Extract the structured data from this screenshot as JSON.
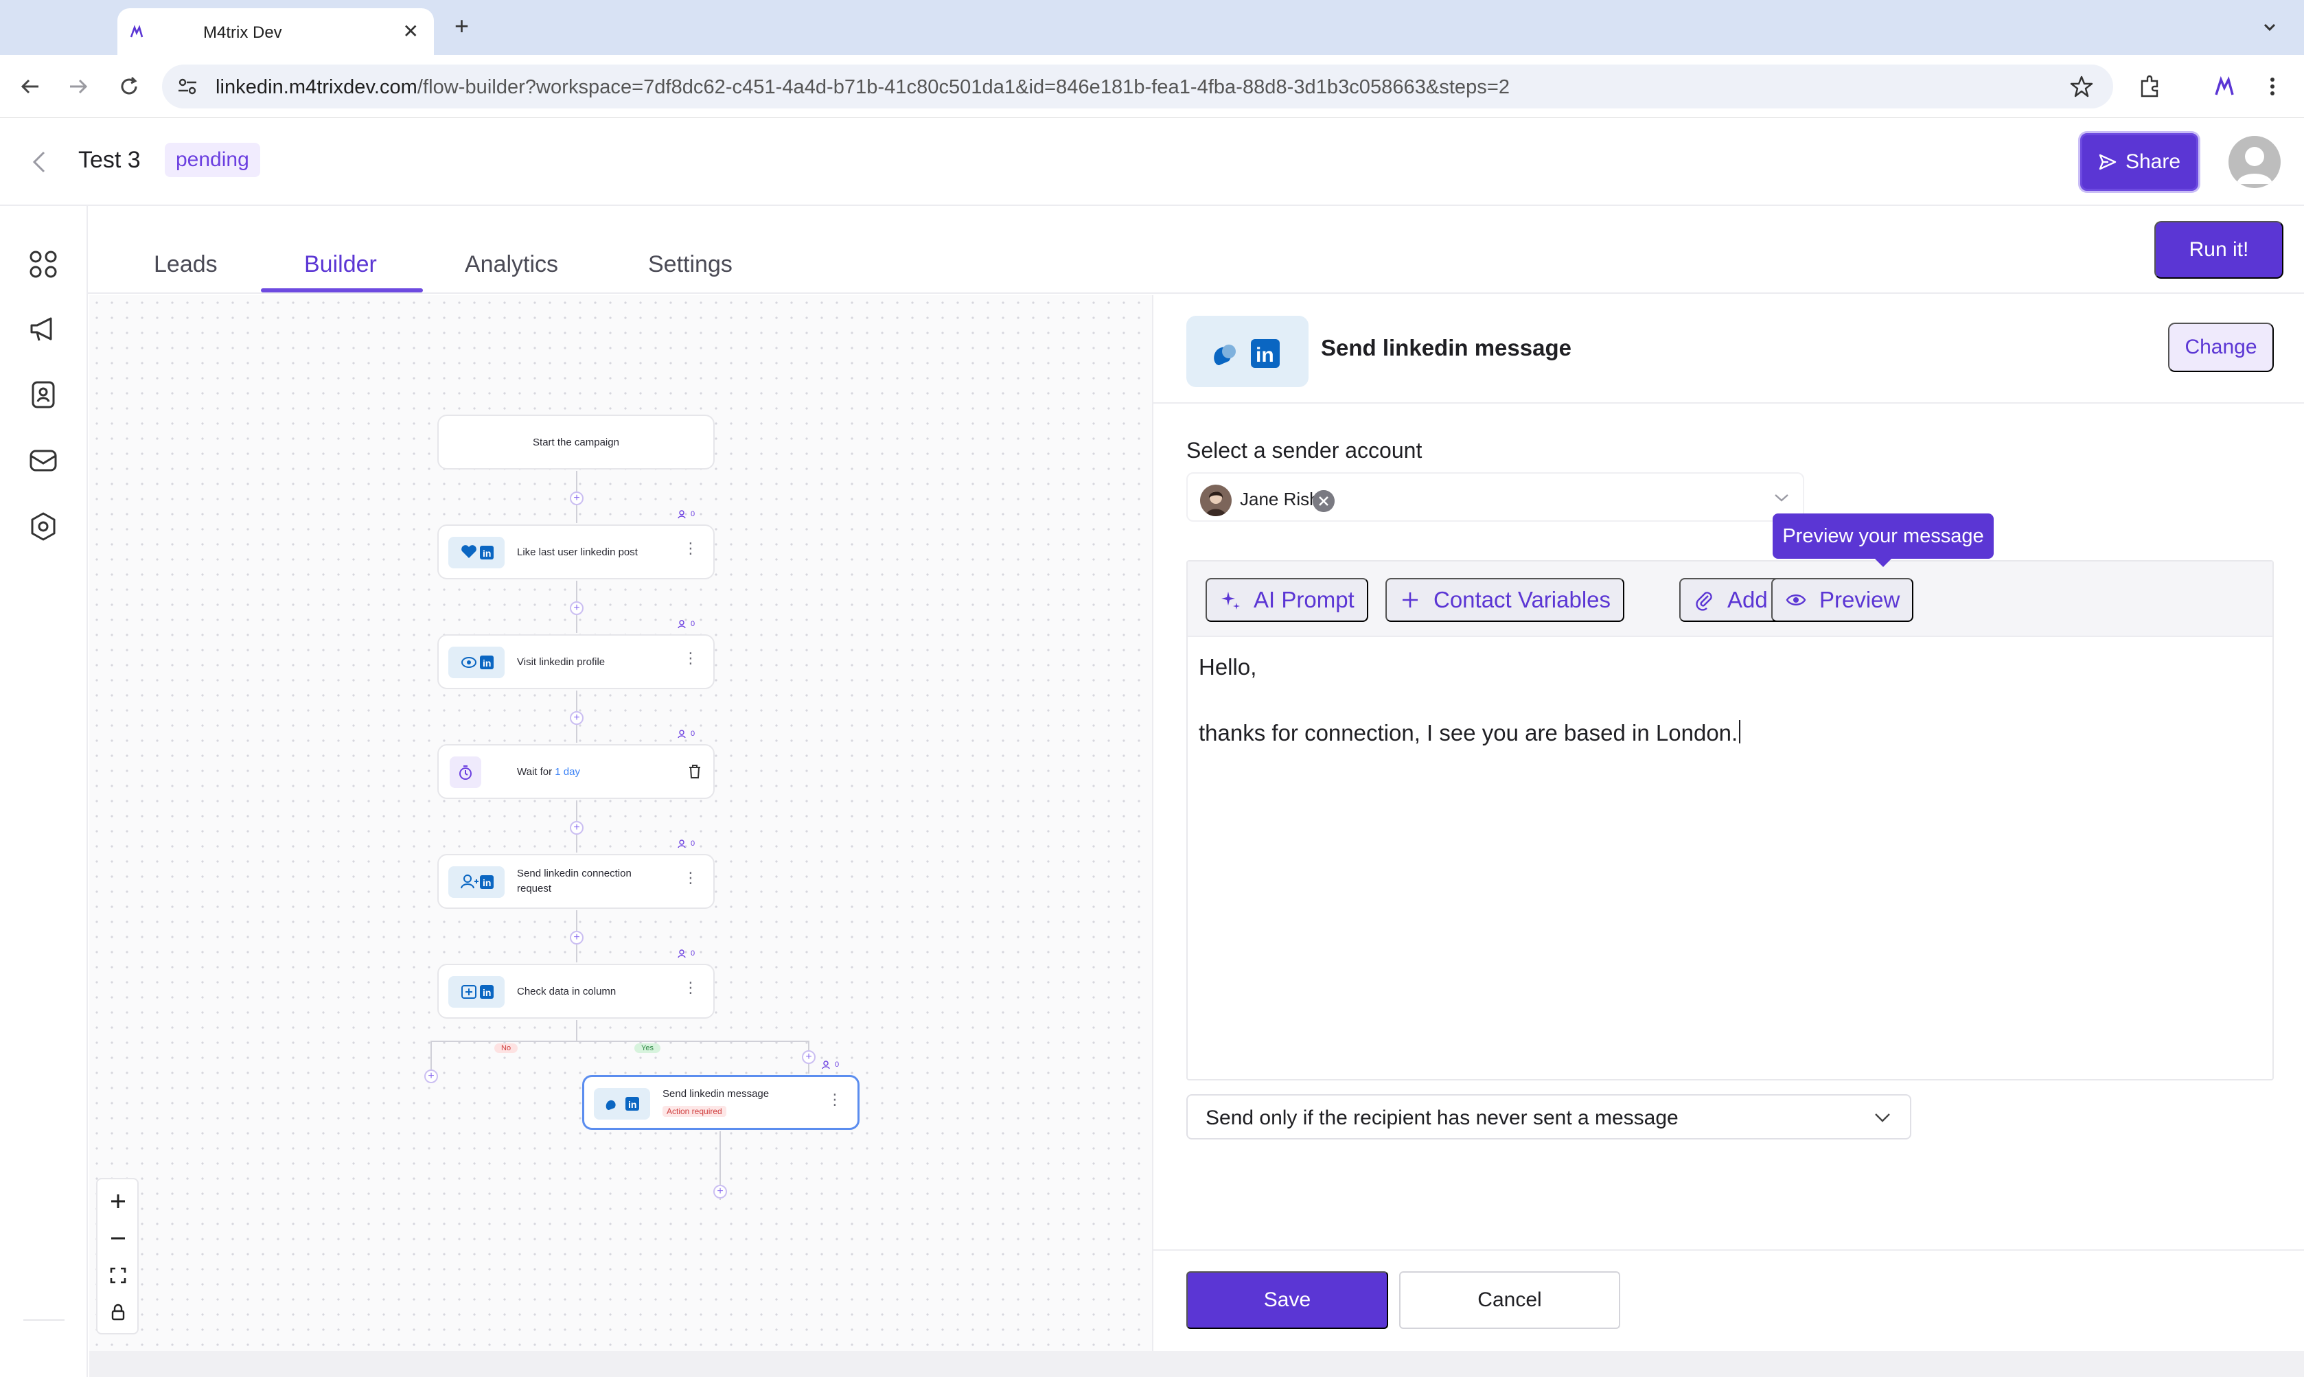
{
  "browser": {
    "tab_title": "M4trix Dev",
    "tab_close": "✕",
    "new_tab": "+",
    "url_host": "linkedin.m4trixdev.com",
    "url_path": "/flow-builder?workspace=7df8dc62-c451-4a4d-b71b-41c80c501da1&id=846e181b-fea1-4fba-88d8-3d1b3c058663&steps=2"
  },
  "header": {
    "title": "Test 3",
    "status": "pending",
    "share_label": "Share"
  },
  "tabs": [
    {
      "label": "Leads"
    },
    {
      "label": "Builder"
    },
    {
      "label": "Analytics"
    },
    {
      "label": "Settings"
    }
  ],
  "active_tab": "Builder",
  "run_label": "Run it!",
  "flow": {
    "start": "Start the campaign",
    "nodes": [
      {
        "label": "Like last user linkedin post",
        "count": "0"
      },
      {
        "label": "Visit linkedin profile",
        "count": "0"
      },
      {
        "label": "Wait for",
        "label_value": "1 day",
        "count": "0"
      },
      {
        "label": "Send linkedin connection request",
        "count": "0"
      },
      {
        "label": "Check data in column",
        "count": "0"
      },
      {
        "label": "Send linkedin message",
        "count": "0",
        "sub": "Action required"
      }
    ],
    "branch_no": "No",
    "branch_yes": "Yes"
  },
  "panel": {
    "title": "Send linkedin message",
    "change_label": "Change",
    "sender_label": "Select a sender account",
    "sender_name": "Jane Rishi",
    "tooltip": "Preview your message",
    "toolbar": {
      "ai_prompt": "AI Prompt",
      "contact_variables": "Contact Variables",
      "add": "Add",
      "preview": "Preview"
    },
    "message_lines": [
      "Hello,",
      "",
      "thanks for connection, I see you are based in London."
    ],
    "condition": "Send only if the recipient has never sent a message",
    "save_label": "Save",
    "cancel_label": "Cancel"
  },
  "colors": {
    "accent": "#5b36d4",
    "status_bg": "#f1ecfe",
    "linkedin": "#0a66c2"
  }
}
